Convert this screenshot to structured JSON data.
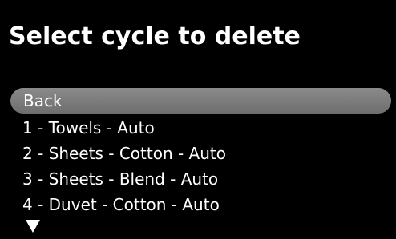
{
  "screen": {
    "title": "Select cycle to delete"
  },
  "menu": {
    "back_label": "Back",
    "items": [
      {
        "label": "1 - Towels - Auto"
      },
      {
        "label": "2 - Sheets - Cotton - Auto"
      },
      {
        "label": "3 - Sheets - Blend - Auto"
      },
      {
        "label": "4 - Duvet - Cotton - Auto"
      }
    ]
  },
  "icons": {
    "more": "scroll-down-arrow-icon"
  },
  "colors": {
    "background": "#000000",
    "text": "#ffffff",
    "selection": "#7d7d7d"
  }
}
